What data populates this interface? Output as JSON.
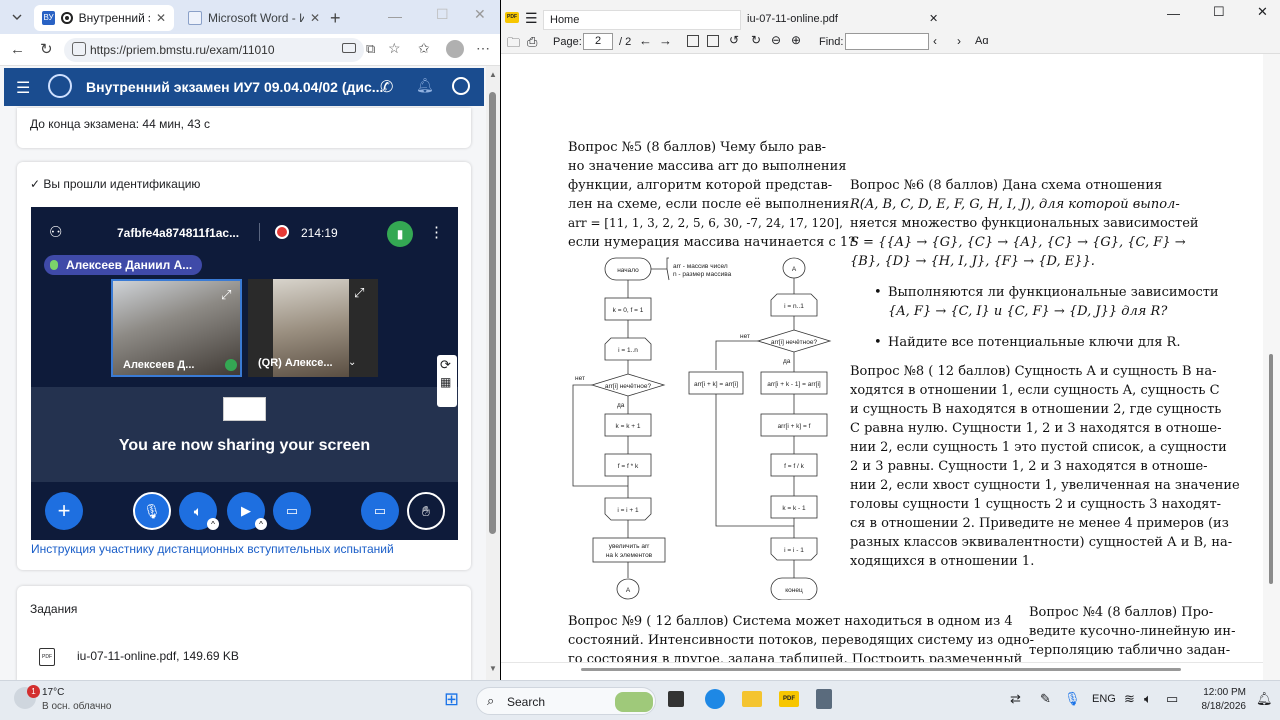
{
  "browser": {
    "tabs": [
      {
        "label": "Внутренний экза",
        "active": true
      },
      {
        "label": "Microsoft Word - Ин",
        "active": false
      }
    ],
    "url": "https://priem.bmstu.ru/exam/11010"
  },
  "app": {
    "title": "Внутренний экзамен ИУ7 09.04.04/02 (дис...",
    "timer_text": "До конца экзамена: 44 мин, 43 с",
    "identification": "✓ Вы прошли идентификацию",
    "instructions_link": "Инструкция участнику дистанционных вступительных испытаний",
    "tasks_title": "Задания",
    "file": {
      "name": "iu-07-11-online.pdf, 149.69 KB"
    }
  },
  "conference": {
    "room_id": "7afbfe4a874811f1ac...",
    "record_time": "214:19",
    "speaker": "Алексеев Даниил А...",
    "participants": [
      "Алексеев Д...",
      "(QR) Алексе..."
    ],
    "sharing_text": "You are now sharing your screen"
  },
  "pdf_viewer": {
    "tabs": [
      "Home",
      "iu-07-11-online.pdf"
    ],
    "page_label": "Page:",
    "page_current": "2",
    "page_total": "/ 2",
    "find_label": "Find:",
    "text_case": "Aɑ"
  },
  "document": {
    "q5": [
      "Вопрос №5 (8 баллов) Чему было рав-",
      "но значение массива arr до выполнения",
      "функции, алгоритм которой представ-",
      "лен на схеме, если после её выполнения",
      "arr = [11, 1, 3, 2, 2, 5, 6, 30, -7, 24, 17, 120],",
      "если нумерация массива начинается с 1?"
    ],
    "q6": [
      "Вопрос №6 (8 баллов) Дана схема отношения",
      "R(A, B, C, D, E, F, G, H, I, J), для которой выпол-",
      "няется множество функциональных зависимостей",
      "S = {{A} → {G}, {C} → {A}, {C} → {G}, {C, F} →",
      "{B}, {D} → {H, I, J}, {F} → {D, E}}."
    ],
    "q6_bullets": [
      "Выполняются ли функциональные зависимости",
      "{A, F} → {C, I} и {C, F} → {D, J}} для R?",
      "Найдите все потенциальные ключи для R."
    ],
    "q8": [
      "Вопрос №8 ( 12 баллов) Сущность A и сущность B на-",
      "ходятся в отношении 1, если сущность A, сущность C",
      "и сущность B находятся в отношении 2, где сущность",
      "C равна нулю. Сущности 1, 2 и 3 находятся в отноше-",
      "нии 2, если сущность 1 это пустой список, а сущности",
      "2 и 3 равны. Сущности 1, 2 и 3 находятся в отноше-",
      "нии 2, если хвост сущности 1, увеличенная на значение",
      "головы сущности 1 сущность 2 и сущность 3 находят-",
      "ся в отношении 2. Приведите не менее 4 примеров (из",
      "разных классов эквивалентности) сущностей A и B, на-",
      "ходящихся в отношении 1."
    ],
    "q9": [
      "Вопрос №9 ( 12 баллов) Система может находиться в одном из 4",
      "состояний. Интенсивности потоков, переводящих систему из одно-",
      "го состояния в другое, задана таблицей. Построить размеченный"
    ],
    "q4": [
      "Вопрос №4 (8 баллов) Про-",
      "ведите кусочно-линейную ин-",
      "терполяцию таблично задан-"
    ],
    "flowchart": {
      "start": "начало",
      "note1": "arr - массив чисел",
      "note2": "n - размер массива",
      "init": "k = 0, f = 1",
      "loop1": "i = 1..n",
      "cond1": "arr[i] нечётное?",
      "no": "нет",
      "yes": "да",
      "k_inc": "k = k + 1",
      "f_mul": "f = f * k",
      "loop1_end": "i = i + 1",
      "grow1": "увеличить arr",
      "grow2": "на k элементов",
      "conn": "A",
      "loop2": "i = n..1",
      "cond2": "arr[i] нечётное?",
      "assign1": "arr[i + k] = arr[i]",
      "assign2": "arr[i + k - 1] = arr[i]",
      "assign3": "arr[i + k] = f",
      "f_div": "f = f / k",
      "k_dec": "k = k - 1",
      "loop2_end": "i = i - 1",
      "end": "конец"
    }
  },
  "taskbar": {
    "weather_temp": "17°C",
    "weather_desc": "В осн. облачно",
    "weather_badge": "1",
    "search": "Search",
    "lang": "ENG",
    "time": "12:00 PM",
    "date": "8/18/2026"
  },
  "colors": {
    "app_header": "#1a4c8f",
    "conference_bg": "#0e1b3a",
    "accent_blue": "#1e6fe0",
    "record_red": "#e53935",
    "signal_green": "#34a853"
  }
}
